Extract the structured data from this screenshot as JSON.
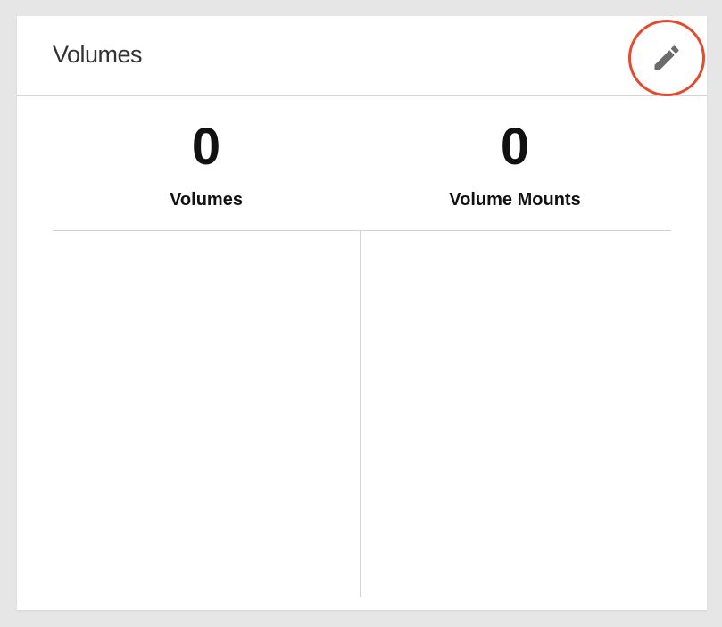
{
  "card": {
    "title": "Volumes",
    "edit_icon": "pencil-icon",
    "highlight_color": "#e64a2e"
  },
  "stats": [
    {
      "value": "0",
      "label": "Volumes"
    },
    {
      "value": "0",
      "label": "Volume Mounts"
    }
  ]
}
